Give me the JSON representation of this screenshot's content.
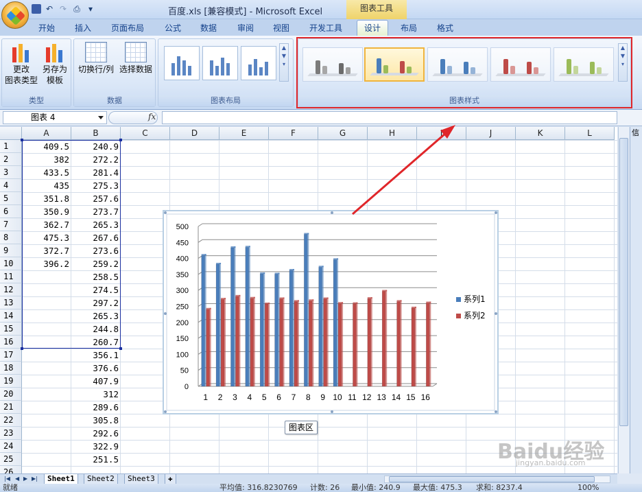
{
  "window": {
    "title": "百度.xls  [兼容模式] - Microsoft Excel",
    "contextual_tab_group": "图表工具"
  },
  "ribbon": {
    "tabs": [
      "开始",
      "插入",
      "页面布局",
      "公式",
      "数据",
      "审阅",
      "视图",
      "开发工具",
      "设计",
      "布局",
      "格式"
    ],
    "active_tab": "设计",
    "groups": {
      "type": {
        "label": "类型",
        "change_type_line1": "更改",
        "change_type_line2": "图表类型",
        "save_template_line1": "另存为",
        "save_template_line2": "模板"
      },
      "data": {
        "label": "数据",
        "switch_row_col": "切换行/列",
        "select_data": "选择数据"
      },
      "layouts": {
        "label": "图表布局"
      },
      "styles": {
        "label": "图表样式"
      }
    }
  },
  "formula_bar": {
    "name_box": "图表 4",
    "fx": "fx",
    "formula": ""
  },
  "sheet": {
    "columns": [
      "A",
      "B",
      "C",
      "D",
      "E",
      "F",
      "G",
      "H",
      "I",
      "J",
      "K",
      "L"
    ],
    "rows": [
      {
        "n": "1",
        "a": "409.5",
        "b": "240.9"
      },
      {
        "n": "2",
        "a": "382",
        "b": "272.2"
      },
      {
        "n": "3",
        "a": "433.5",
        "b": "281.4"
      },
      {
        "n": "4",
        "a": "435",
        "b": "275.3"
      },
      {
        "n": "5",
        "a": "351.8",
        "b": "257.6"
      },
      {
        "n": "6",
        "a": "350.9",
        "b": "273.7"
      },
      {
        "n": "7",
        "a": "362.7",
        "b": "265.3"
      },
      {
        "n": "8",
        "a": "475.3",
        "b": "267.6"
      },
      {
        "n": "9",
        "a": "372.7",
        "b": "273.6"
      },
      {
        "n": "10",
        "a": "396.2",
        "b": "259.2"
      },
      {
        "n": "11",
        "a": "",
        "b": "258.5"
      },
      {
        "n": "12",
        "a": "",
        "b": "274.5"
      },
      {
        "n": "13",
        "a": "",
        "b": "297.2"
      },
      {
        "n": "14",
        "a": "",
        "b": "265.3"
      },
      {
        "n": "15",
        "a": "",
        "b": "244.8"
      },
      {
        "n": "16",
        "a": "",
        "b": "260.7"
      },
      {
        "n": "17",
        "a": "",
        "b": "356.1"
      },
      {
        "n": "18",
        "a": "",
        "b": "376.6"
      },
      {
        "n": "19",
        "a": "",
        "b": "407.9"
      },
      {
        "n": "20",
        "a": "",
        "b": "312"
      },
      {
        "n": "21",
        "a": "",
        "b": "289.6"
      },
      {
        "n": "22",
        "a": "",
        "b": "305.8"
      },
      {
        "n": "23",
        "a": "",
        "b": "292.6"
      },
      {
        "n": "24",
        "a": "",
        "b": "322.9"
      },
      {
        "n": "25",
        "a": "",
        "b": "251.5"
      },
      {
        "n": "26",
        "a": "",
        "b": ""
      }
    ],
    "sheet_tabs": [
      "Sheet1",
      "Sheet2",
      "Sheet3"
    ]
  },
  "chart_tooltip": "图表区",
  "status_bar": {
    "ready": "就绪",
    "average": "平均值: 316.8230769",
    "count": "计数: 26",
    "min": "最小值: 240.9",
    "max": "最大值: 475.3",
    "sum": "求和: 8237.4",
    "zoom": "100%"
  },
  "right_pane_label": "信",
  "watermark": {
    "main": "Baidu经验",
    "sub": "jingyan.baidu.com"
  },
  "colors": {
    "series1": "#4a7ebb",
    "series2": "#be4b48",
    "annotation": "#e0262a",
    "accent": "#15428b"
  },
  "chart_data": {
    "type": "bar",
    "categories": [
      "1",
      "2",
      "3",
      "4",
      "5",
      "6",
      "7",
      "8",
      "9",
      "10",
      "11",
      "12",
      "13",
      "14",
      "15",
      "16"
    ],
    "series": [
      {
        "name": "系列1",
        "values": [
          409.5,
          382,
          433.5,
          435,
          351.8,
          350.9,
          362.7,
          475.3,
          372.7,
          396.2,
          null,
          null,
          null,
          null,
          null,
          null
        ]
      },
      {
        "name": "系列2",
        "values": [
          240.9,
          272.2,
          281.4,
          275.3,
          257.6,
          273.7,
          265.3,
          267.6,
          273.6,
          259.2,
          258.5,
          274.5,
          297.2,
          265.3,
          244.8,
          260.7
        ]
      }
    ],
    "yticks": [
      "0",
      "50",
      "100",
      "150",
      "200",
      "250",
      "300",
      "350",
      "400",
      "450",
      "500"
    ],
    "ylim": [
      0,
      500
    ],
    "grid": true,
    "legend": "right"
  }
}
